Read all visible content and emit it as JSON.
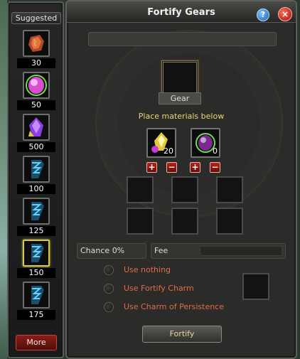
{
  "sidebar": {
    "title": "Suggested",
    "items": [
      {
        "icon": "red-ore-icon",
        "count": "30"
      },
      {
        "icon": "pink-gem-icon",
        "count": "50"
      },
      {
        "icon": "purple-crystal-icon",
        "count": "500"
      },
      {
        "icon": "blue-armor-piece-icon",
        "count": "100"
      },
      {
        "icon": "blue-armor-piece-icon",
        "count": "125"
      },
      {
        "icon": "blue-armor-piece-icon",
        "count": "150"
      },
      {
        "icon": "blue-armor-piece-icon",
        "count": "175"
      }
    ],
    "more_label": "More"
  },
  "window": {
    "title": "Fortify Gears",
    "help_label": "?",
    "close_label": "×"
  },
  "gear": {
    "label": "Gear"
  },
  "materials": {
    "instruction": "Place materials below",
    "slots": [
      {
        "icon": "yellow-crystal-icon",
        "count": "20"
      },
      {
        "icon": "green-gem-icon",
        "count": "0"
      }
    ],
    "plus_label": "+",
    "minus_label": "−"
  },
  "stats": {
    "chance_label": "Chance",
    "chance_value": "0%",
    "fee_label": "Fee"
  },
  "options": [
    {
      "label": "Use nothing"
    },
    {
      "label": "Use Fortify Charm"
    },
    {
      "label": "Use Charm of Persistence"
    }
  ],
  "fortify_label": "Fortify",
  "colors": {
    "accent_gold": "#e9d676",
    "option_text": "#e06c48",
    "button_red": "#8a1d17"
  }
}
